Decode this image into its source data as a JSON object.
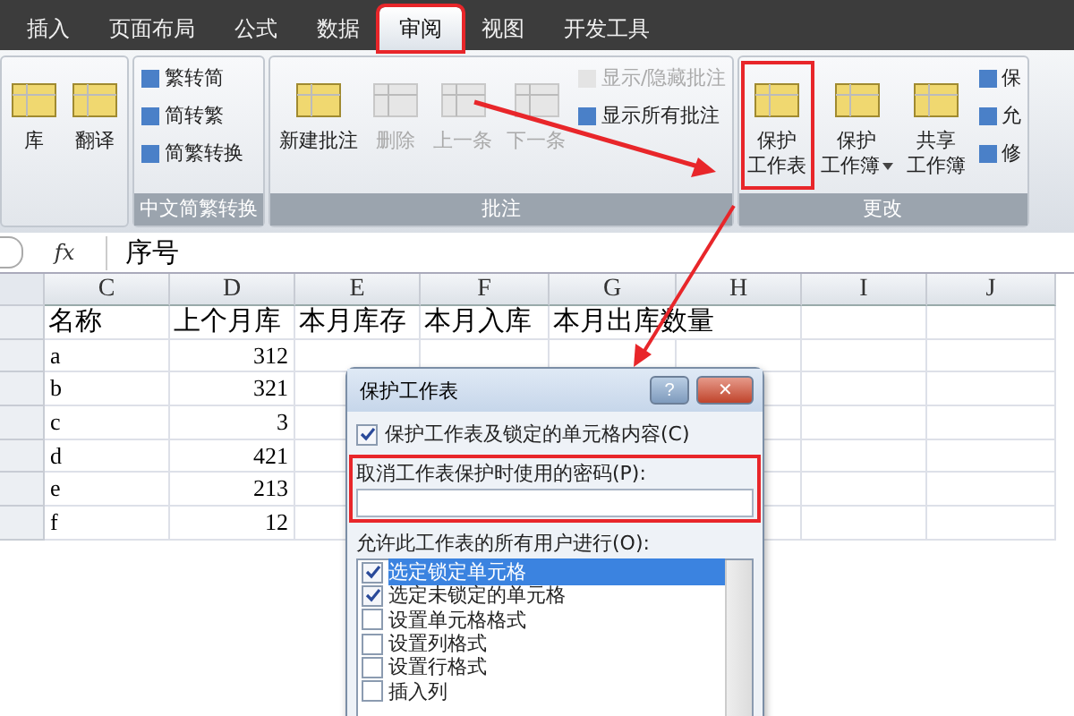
{
  "tabs": [
    {
      "label": "插入",
      "selected": false,
      "highlighted": false
    },
    {
      "label": "页面布局",
      "selected": false,
      "highlighted": false
    },
    {
      "label": "公式",
      "selected": false,
      "highlighted": false
    },
    {
      "label": "数据",
      "selected": false,
      "highlighted": false
    },
    {
      "label": "审阅",
      "selected": true,
      "highlighted": true
    },
    {
      "label": "视图",
      "selected": false,
      "highlighted": false
    },
    {
      "label": "开发工具",
      "selected": false,
      "highlighted": false
    }
  ],
  "ribbon": {
    "groups": [
      {
        "items": [
          {
            "kind": "large",
            "lines": [
              "库"
            ],
            "disabled": false,
            "highlighted": false,
            "dropdown": false
          },
          {
            "kind": "large",
            "lines": [
              "翻译"
            ],
            "disabled": false,
            "highlighted": false,
            "dropdown": false
          }
        ]
      },
      {
        "title": "中文简繁转换",
        "items": [
          {
            "kind": "stack",
            "items": [
              {
                "label": "繁转简",
                "disabled": false
              },
              {
                "label": "简转繁",
                "disabled": false
              },
              {
                "label": "简繁转换",
                "disabled": false
              }
            ]
          }
        ]
      },
      {
        "title": "批注",
        "items": [
          {
            "kind": "large",
            "lines": [
              "新建批注"
            ],
            "disabled": false,
            "highlighted": false,
            "dropdown": false
          },
          {
            "kind": "large",
            "lines": [
              "删除"
            ],
            "disabled": true,
            "highlighted": false,
            "dropdown": false
          },
          {
            "kind": "large",
            "lines": [
              "上一条"
            ],
            "disabled": true,
            "highlighted": false,
            "dropdown": false
          },
          {
            "kind": "large",
            "lines": [
              "下一条"
            ],
            "disabled": true,
            "highlighted": false,
            "dropdown": false
          },
          {
            "kind": "stack",
            "items": [
              {
                "label": "显示/隐藏批注",
                "disabled": true
              },
              {
                "label": "显示所有批注",
                "disabled": false
              }
            ]
          }
        ]
      },
      {
        "title": "更改",
        "items": [
          {
            "kind": "large",
            "lines": [
              "保护",
              "工作表"
            ],
            "disabled": false,
            "highlighted": true,
            "dropdown": false
          },
          {
            "kind": "large",
            "lines": [
              "保护",
              "工作簿"
            ],
            "disabled": false,
            "highlighted": false,
            "dropdown": true
          },
          {
            "kind": "large",
            "lines": [
              "共享",
              "工作簿"
            ],
            "disabled": false,
            "highlighted": false,
            "dropdown": false
          },
          {
            "kind": "stack",
            "items": [
              {
                "label": "保",
                "disabled": false
              },
              {
                "label": "允",
                "disabled": false
              },
              {
                "label": "修",
                "disabled": false
              }
            ]
          }
        ]
      }
    ]
  },
  "formula_bar": {
    "fx": "fx",
    "value": "序号"
  },
  "columns": [
    "C",
    "D",
    "E",
    "F",
    "G",
    "H",
    "I",
    "J"
  ],
  "rows": [
    [
      "名称",
      "上个月库",
      "本月库存",
      "本月入库",
      "本月出库数量"
    ],
    [
      "a",
      "312"
    ],
    [
      "b",
      "321"
    ],
    [
      "c",
      "3"
    ],
    [
      "d",
      "421"
    ],
    [
      "e",
      "213"
    ],
    [
      "f",
      "12"
    ]
  ],
  "dialog": {
    "title": "保护工作表",
    "help_button": "?",
    "close_button": "✕",
    "protect_label": "保护工作表及锁定的单元格内容(C)",
    "protect_checked": true,
    "password_label": "取消工作表保护时使用的密码(P):",
    "password_highlighted": true,
    "allow_label": "允许此工作表的所有用户进行(O):",
    "permissions": [
      {
        "label": "选定锁定单元格",
        "checked": true,
        "selected": true
      },
      {
        "label": "选定未锁定的单元格",
        "checked": true,
        "selected": false
      },
      {
        "label": "设置单元格格式",
        "checked": false,
        "selected": false
      },
      {
        "label": "设置列格式",
        "checked": false,
        "selected": false
      },
      {
        "label": "设置行格式",
        "checked": false,
        "selected": false
      },
      {
        "label": "插入列",
        "checked": false,
        "selected": false
      }
    ]
  }
}
